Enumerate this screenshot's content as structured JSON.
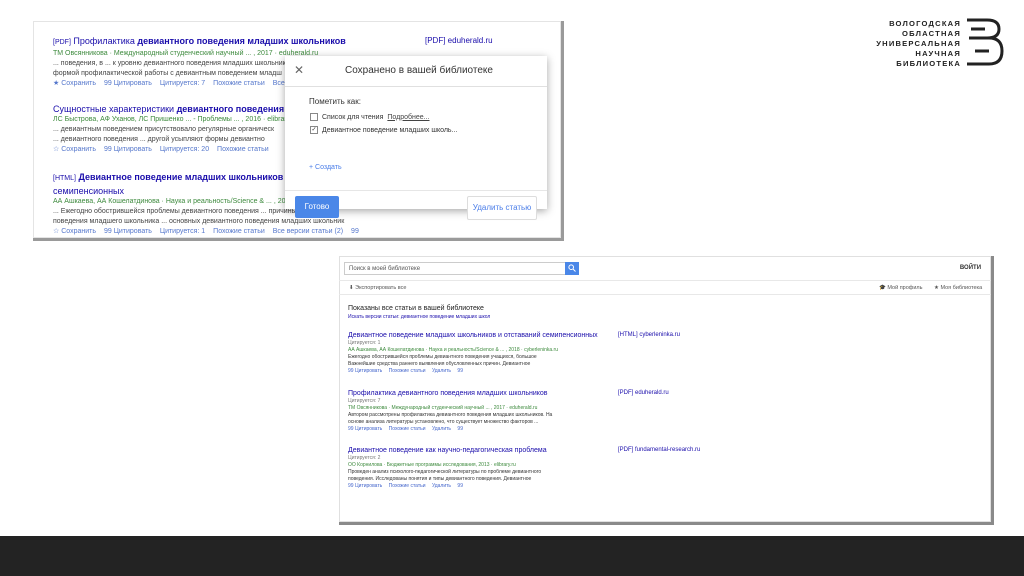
{
  "library_dialog_shot": {
    "results": [
      {
        "tag": "[PDF]",
        "title_plain": "Профилактика ",
        "title_bold": "девиантного поведения младших школьников",
        "authors": "ТМ Овсянникова · Международный студенческий научный ... , 2017 · eduherald.ru",
        "snippet1": "... поведения, в ... к уровню девиантного поведения младших школьников. Н",
        "snippet2": "формой профилактической работы с девиантным поведением младш",
        "links": [
          "★ Сохранить",
          "99 Цитировать",
          "Цитируется: 7",
          "Похожие статьи",
          "Все в"
        ],
        "source": "[PDF] eduherald.ru"
      },
      {
        "tag": "",
        "title_plain": "Сущностные характеристики ",
        "title_bold": "девиантного поведения",
        "authors": "ЛС Быстрова, АФ Уханов, ЛС Пришенко ... - Проблемы ... , 2016 · elibrary.",
        "snippet1": "... девиантным поведением присутствовало регулярные органическ",
        "snippet2": "... девиантного поведения ... другой усыпляют формы девиантно",
        "links": [
          "☆ Сохранить",
          "99 Цитировать",
          "Цитируется: 20",
          "Похожие статьи"
        ],
        "source": ""
      },
      {
        "tag": "[HTML]",
        "title_plain": "",
        "title_bold": "Девиантное поведение младших школьников",
        "title_line2": "семипенсионных",
        "authors": "АА Ашкаева, АА Кошелатдинова · Наука и реальность/Science & ... , 2018",
        "snippet1": "... Ежегодно обострившейся проблемы девиантного поведения ... причины девиантного",
        "snippet2": "поведения младшего школьника ... основных девиантного поведения младших школьник",
        "links": [
          "☆ Сохранить",
          "99 Цитировать",
          "Цитируется: 1",
          "Похожие статьи",
          "Все версии статьи (2)",
          "99"
        ],
        "source": ""
      }
    ],
    "dialog": {
      "title": "Сохранено в вашей библиотеке",
      "close": "✕",
      "mark_as": "Пометить как:",
      "options": [
        {
          "checked": false,
          "label": "Список для чтения",
          "link": "Подробнее..."
        },
        {
          "checked": true,
          "label": "Девиантное поведение младших школь...",
          "link": ""
        }
      ],
      "create": "+ Создать",
      "done": "Готово",
      "delete": "Удалить статью"
    }
  },
  "logo": {
    "lines": [
      "ВОЛОГОДСКАЯ",
      "ОБЛАСТНАЯ",
      "УНИВЕРСАЛЬНАЯ",
      "НАУЧНАЯ",
      "БИБЛИОТЕКА"
    ]
  },
  "library_shot": {
    "search_placeholder": "Поиск в моей библиотеке",
    "login": "ВОЙТИ",
    "export": "Экспортировать все",
    "my_profile": "Мой профиль",
    "my_library": "Моя библиотека",
    "showing": "Показаны все статьи в вашей библиотеке",
    "include": "Искать версии статьи: девиантное поведение младших школ",
    "results": [
      {
        "title": "Девиантное поведение младших школьников и отставаний семипенсионных",
        "cited": "Цитируется: 1",
        "authors": "АА Ашкаева, АА Кошелатдинова · Наука и реальность/Science & ... , 2018 · cyberleninka.ru",
        "snippet1": "Ежегодно обострившейся проблемы девиантного поведения учащихся, большое",
        "snippet2": "Важнейшие средства раннего выявления обусловленных причин. Девиантное",
        "links": [
          "99 Цитировать",
          "Похожие статьи",
          "Удалить",
          "99"
        ],
        "source": "[HTML] cyberleninka.ru"
      },
      {
        "title": "Профилактика девиантного поведения младших школьников",
        "cited": "Цитируется: 7",
        "authors": "ТМ Овсянникова · Международный студенческий научный ... , 2017 · eduherald.ru",
        "snippet1": "Автором рассмотрены профилактика девиантного поведения младших школьников. На",
        "snippet2": "основе анализа литературы установлено, что существует множество факторов ...",
        "links": [
          "99 Цитировать",
          "Похожие статьи",
          "Удалить",
          "99"
        ],
        "source": "[PDF] eduherald.ru"
      },
      {
        "title": "Девиантное поведение как научно-педагогическая проблема",
        "cited": "Цитируется: 2",
        "authors": "ОО Корнилова · Бюджетные программы исследования, 2013 · elibrary.ru",
        "snippet1": "Проведен анализ психолого-педагогической литературы по проблеме девиантного",
        "snippet2": "поведения. Исследованы понятия и типы девиантного поведения. Девиантное",
        "links": [
          "99 Цитировать",
          "Похожие статьи",
          "Удалить",
          "99"
        ],
        "source": "[PDF] fundamental-research.ru"
      }
    ]
  },
  "colors": {
    "link_blue": "#1a0dab",
    "author_green": "#3d8a3d",
    "accent_blue": "#4a87e8",
    "bottom_bar": "#232323"
  }
}
